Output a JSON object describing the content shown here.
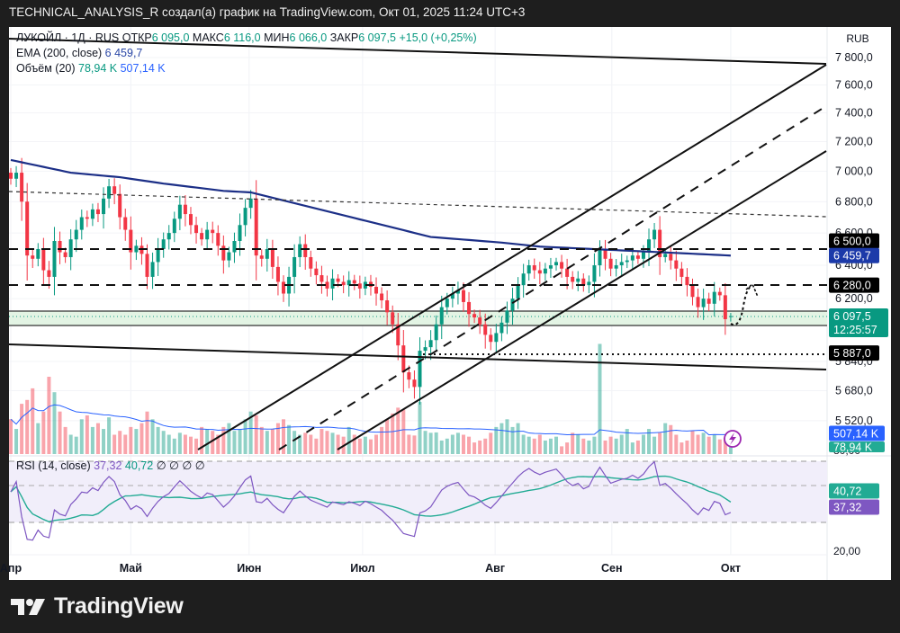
{
  "header": {
    "title": "TECHNICAL_ANALYSIS_R создал(а) график на TradingView.com, Окт 01, 2025 11:24 UTC+3"
  },
  "legend": {
    "symbol": "ЛУКОЙЛ · 1Д · RUS",
    "open_label": "ОТКР",
    "open": "6 095,0",
    "high_label": "МАКС",
    "high": "6 116,0",
    "low_label": "МИН",
    "low": "6 066,0",
    "close_label": "ЗАКР",
    "close": "6 097,5",
    "change": "+15,0 (+0,25%)",
    "ema_label": "EMA (200, close)",
    "ema_value": "6 459,7",
    "vol_label": "Объём (20)",
    "vol_value": "78,94 K",
    "vol_ma_value": "507,14 K",
    "rsi_label": "RSI (14, close)",
    "rsi_value": "37,32",
    "rsi_ma_value": "40,72",
    "rsi_extra": "∅ ∅ ∅ ∅"
  },
  "axis": {
    "currency": "RUB"
  },
  "badges": {
    "level_6500": "6 500,0",
    "ema": "6 459,7",
    "level_6280": "6 280,0",
    "last": "6 097,5",
    "countdown": "12:25:57",
    "level_5887": "5 887,0",
    "vol_ma": "507,14 K",
    "vol": "78,94 K",
    "rsi_ma": "40,72",
    "rsi": "37,32"
  },
  "brand": {
    "name": "TradingView"
  },
  "colors": {
    "up": "#089981",
    "down": "#f23645",
    "ema": "#1c2f87",
    "vol_ma": "#2962ff",
    "rsi": "#7e57c2",
    "rsi_ma": "#22ab94"
  },
  "chart_data": {
    "type": "candlestick",
    "title": "ЛУКОЙЛ · 1Д · RUS",
    "ylabel": "RUB",
    "ylim": [
      5450,
      7850
    ],
    "yscale": "log",
    "y_ticks": [
      7800,
      7600,
      7400,
      7200,
      7000,
      6800,
      6600,
      6400,
      6200,
      5840,
      5680,
      5520
    ],
    "y_tick_labels": [
      "7 800,0",
      "7 600,0",
      "7 400,0",
      "7 200,0",
      "7 000,0",
      "6 800,0",
      "6 600,0",
      "6 400,0",
      "6 200,0",
      "5 840,0",
      "5 680,0",
      "5 520,0"
    ],
    "x_ticks": [
      {
        "label": "Апр",
        "index": 0
      },
      {
        "label": "Май",
        "index": 22
      },
      {
        "label": "Июн",
        "index": 43.7
      },
      {
        "label": "Июл",
        "index": 64.5
      },
      {
        "label": "Авг",
        "index": 88.8
      },
      {
        "label": "Сен",
        "index": 110.2
      },
      {
        "label": "Окт",
        "index": 132
      }
    ],
    "closes": [
      6950,
      6990,
      6800,
      6460,
      6440,
      6500,
      6370,
      6330,
      6550,
      6480,
      6450,
      6560,
      6620,
      6700,
      6690,
      6750,
      6720,
      6820,
      6900,
      6850,
      6700,
      6620,
      6480,
      6520,
      6470,
      6330,
      6420,
      6500,
      6560,
      6600,
      6690,
      6780,
      6720,
      6650,
      6600,
      6560,
      6620,
      6600,
      6520,
      6430,
      6480,
      6550,
      6650,
      6760,
      6820,
      6460,
      6440,
      6500,
      6390,
      6300,
      6230,
      6330,
      6450,
      6530,
      6450,
      6380,
      6340,
      6300,
      6260,
      6320,
      6300,
      6280,
      6310,
      6290,
      6260,
      6300,
      6270,
      6230,
      6190,
      6120,
      6050,
      5930,
      5780,
      5740,
      5700,
      5900,
      5920,
      5960,
      6050,
      6150,
      6200,
      6230,
      6250,
      6180,
      6110,
      6090,
      6050,
      5990,
      5950,
      6000,
      6060,
      6130,
      6200,
      6280,
      6350,
      6400,
      6370,
      6350,
      6380,
      6400,
      6420,
      6380,
      6330,
      6300,
      6320,
      6280,
      6300,
      6400,
      6500,
      6440,
      6380,
      6400,
      6420,
      6430,
      6460,
      6440,
      6480,
      6560,
      6620,
      6450,
      6470,
      6430,
      6380,
      6330,
      6280,
      6210,
      6150,
      6200,
      6170,
      6240,
      6220,
      6080,
      6097.5
    ],
    "last_candle": {
      "open": 6095,
      "high": 6116,
      "low": 6066,
      "close": 6097.5
    },
    "volume_k": [
      900,
      650,
      1300,
      1400,
      1700,
      800,
      1100,
      2000,
      1600,
      1100,
      700,
      500,
      450,
      900,
      1000,
      700,
      800,
      650,
      950,
      500,
      600,
      500,
      700,
      650,
      800,
      1100,
      900,
      700,
      600,
      500,
      400,
      550,
      500,
      450,
      400,
      700,
      650,
      600,
      500,
      700,
      800,
      600,
      650,
      900,
      1100,
      1000,
      700,
      600,
      650,
      800,
      900,
      750,
      600,
      500,
      550,
      500,
      400,
      650,
      600,
      550,
      500,
      450,
      700,
      500,
      400,
      450,
      380,
      500,
      700,
      900,
      1050,
      1200,
      1150,
      500,
      480,
      1350,
      600,
      550,
      560,
      350,
      400,
      500,
      550,
      500,
      450,
      300,
      350,
      400,
      550,
      700,
      800,
      900,
      700,
      800,
      500,
      450,
      400,
      500,
      350,
      400,
      450,
      200,
      300,
      550,
      500,
      400,
      350,
      450,
      2850,
      350,
      450,
      400,
      500,
      650,
      300,
      350,
      500,
      650,
      450,
      550,
      800,
      750,
      500,
      300,
      350,
      600,
      500,
      550,
      450,
      500,
      380,
      420,
      250,
      79
    ],
    "ema200": [
      [
        0,
        7075
      ],
      [
        11,
        6990
      ],
      [
        20,
        6960
      ],
      [
        28,
        6918
      ],
      [
        39,
        6870
      ],
      [
        44,
        6860
      ],
      [
        52,
        6790
      ],
      [
        64,
        6686
      ],
      [
        77,
        6575
      ],
      [
        90,
        6540
      ],
      [
        97,
        6515
      ],
      [
        113,
        6490
      ],
      [
        132,
        6459.7
      ]
    ],
    "levels": [
      6500,
      6280,
      5887
    ],
    "rsi_levels": [
      70,
      50,
      30
    ],
    "rsi_axis_labels": [
      "80,00",
      "20,00"
    ]
  }
}
